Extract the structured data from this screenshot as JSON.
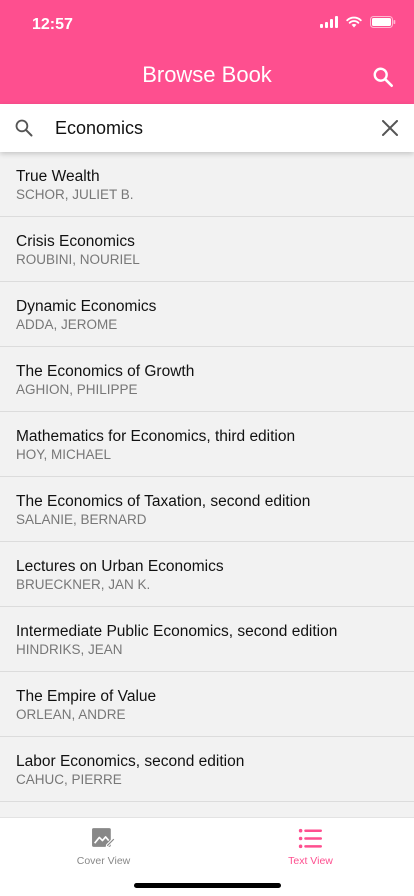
{
  "status": {
    "time": "12:57"
  },
  "header": {
    "title": "Browse Book"
  },
  "search": {
    "value": "Economics"
  },
  "books": [
    {
      "title": "True Wealth",
      "author": "SCHOR, JULIET B."
    },
    {
      "title": "Crisis Economics",
      "author": "ROUBINI, NOURIEL"
    },
    {
      "title": "Dynamic Economics",
      "author": "ADDA, JEROME"
    },
    {
      "title": "The Economics of Growth",
      "author": "AGHION, PHILIPPE"
    },
    {
      "title": "Mathematics for Economics, third edition",
      "author": "HOY, MICHAEL"
    },
    {
      "title": "The Economics of Taxation, second edition",
      "author": "SALANIE, BERNARD"
    },
    {
      "title": "Lectures on Urban Economics",
      "author": "BRUECKNER, JAN K."
    },
    {
      "title": "Intermediate Public Economics, second edition",
      "author": "HINDRIKS, JEAN"
    },
    {
      "title": "The Empire of Value",
      "author": "ORLEAN, ANDRE"
    },
    {
      "title": "Labor Economics, second edition",
      "author": "CAHUC, PIERRE"
    }
  ],
  "tabs": [
    {
      "label": "Cover View",
      "icon": "image-edit-icon",
      "active": false
    },
    {
      "label": "Text View",
      "icon": "list-icon",
      "active": true
    }
  ],
  "colors": {
    "accent": "#fe4f8f",
    "inactive": "#888888"
  }
}
